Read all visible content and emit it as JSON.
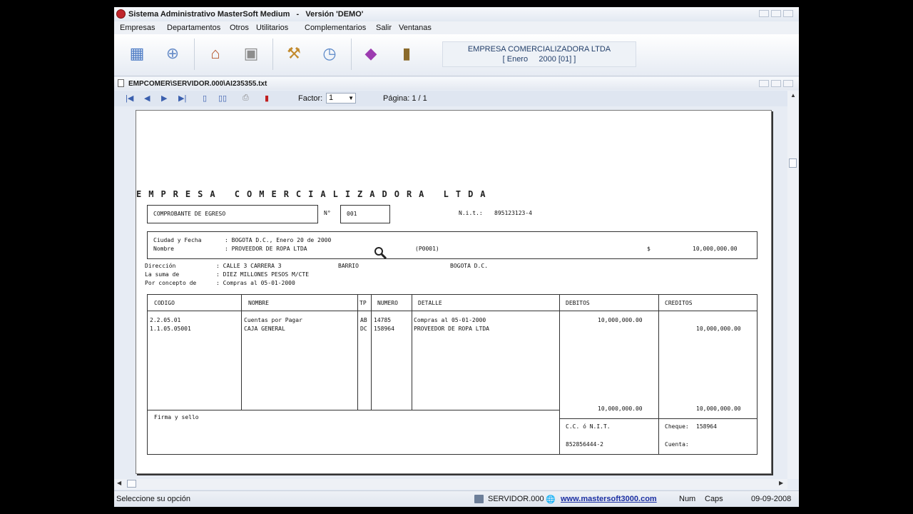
{
  "window": {
    "title": "Sistema Administrativo MasterSoft Medium   -   Versión 'DEMO'"
  },
  "menu": [
    "Empresas",
    "Departamentos",
    "Otros",
    "Utilitarios",
    "Complementarios",
    "Salir",
    "Ventanas"
  ],
  "toolbar": {
    "icons": [
      "calculator-icon",
      "search-globe-icon",
      "home-icon",
      "safe-icon",
      "tools-icon",
      "clock-icon",
      "book-icon",
      "exit-door-icon"
    ],
    "company_name": "EMPRESA COMERCIALIZADORA LTDA",
    "period": "[ Enero     2000 [01] ]"
  },
  "document_window": {
    "path": "EMPCOMER\\SERVIDOR.000\\AI235355.txt"
  },
  "viewer_toolbar": {
    "factor_label": "Factor:",
    "factor_value": "1",
    "page_label": "Página: 1 / 1"
  },
  "report": {
    "company_title": "EMPRESA COMERCIALIZADORA LTDA",
    "voucher_type": "COMPROBANTE DE EGRESO",
    "number_label": "N°",
    "number_value": "001",
    "nit_label": "N.i.t.:",
    "nit_value": "895123123-4",
    "city_date_label": "Ciudad y Fecha",
    "city_date_value": ": BOGOTA D.C., Enero 20 de 2000",
    "name_label": "Nombre",
    "name_value": ": PROVEEDOR DE ROPA LTDA",
    "provider_code": "(P0001)",
    "currency_symbol": "$",
    "amount": "10,000,000.00",
    "address_label": "Dirección",
    "address_value": ": CALLE 3 CARRERA 3",
    "barrio_label": "BARRIO",
    "city_value": "BOGOTA D.C.",
    "sum_label": "La suma de",
    "sum_value": ": DIEZ MILLONES PESOS M/CTE",
    "concept_label": "Por concepto de",
    "concept_value": ": Compras al 05-01-2000",
    "table_headers": {
      "codigo": "CODIGO",
      "nombre": "NOMBRE",
      "tp": "TP",
      "numero": "NUMERO",
      "detalle": "DETALLE",
      "debitos": "DEBITOS",
      "creditos": "CREDITOS"
    },
    "rows": [
      {
        "codigo": "2.2.05.01",
        "nombre": "Cuentas por Pagar",
        "tp": "AB",
        "numero": "14785",
        "detalle": "Compras al 05-01-2000",
        "debito": "10,000,000.00",
        "credito": ""
      },
      {
        "codigo": "1.1.05.05001",
        "nombre": "CAJA GENERAL",
        "tp": "DC",
        "numero": "158964",
        "detalle": "PROVEEDOR DE ROPA LTDA",
        "debito": "",
        "credito": "10,000,000.00"
      }
    ],
    "total_debitos": "10,000,000.00",
    "total_creditos": "10,000,000.00",
    "signature_label": "Firma y sello",
    "cc_nit_label": "C.C. ó N.I.T.",
    "cc_nit_value": "852856444-2",
    "cheque_label": "Cheque:",
    "cheque_value": "158964",
    "cuenta_label": "Cuenta:"
  },
  "statusbar": {
    "hint": "Seleccione su opción",
    "server": "SERVIDOR.000",
    "website": "www.mastersoft3000.com",
    "num": "Num",
    "caps": "Caps",
    "date": "09-09-2008"
  }
}
